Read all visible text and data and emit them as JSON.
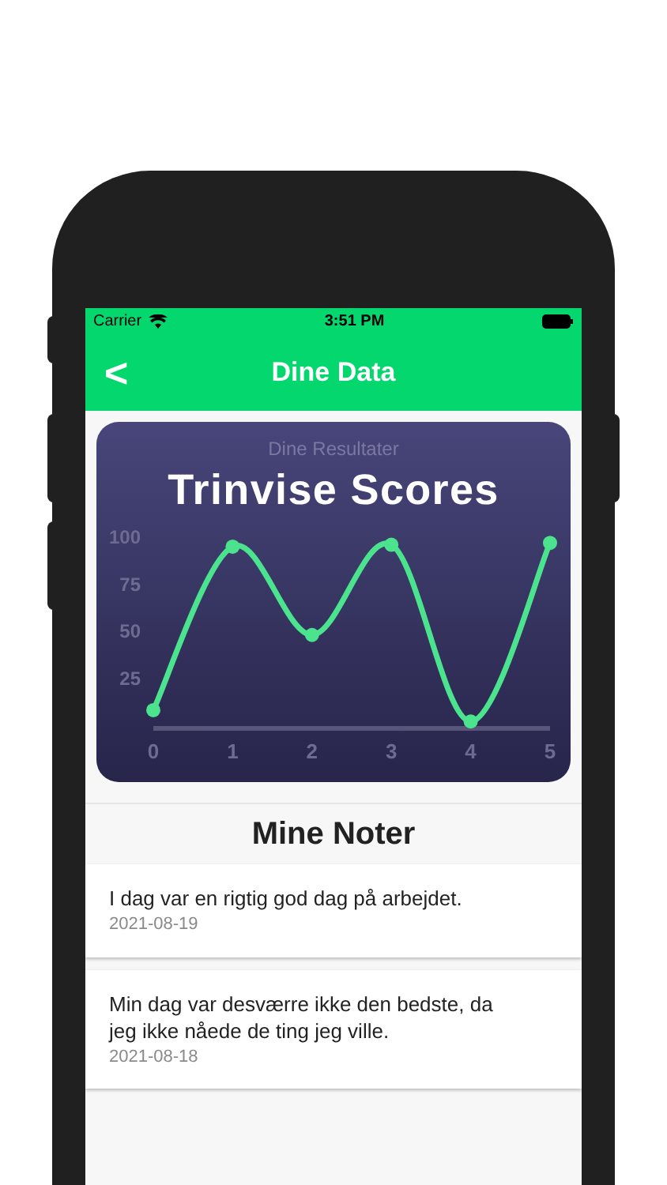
{
  "status_bar": {
    "carrier": "Carrier",
    "time": "3:51 PM"
  },
  "nav_bar": {
    "back": "<",
    "title": "Dine Data"
  },
  "chart_card": {
    "subtitle": "Dine Resultater",
    "title": "Trinvise Scores",
    "chart_data": {
      "type": "line",
      "x": [
        0,
        1,
        2,
        3,
        4,
        5
      ],
      "series": [
        {
          "color": "#4be38e",
          "marker": "circle",
          "values": [
            8,
            95,
            48,
            96,
            2,
            97
          ]
        }
      ],
      "xlim": [
        0,
        5
      ],
      "ylim": [
        0,
        100
      ],
      "yticks": [
        25,
        50,
        75,
        100
      ],
      "xticks": [
        0,
        1,
        2,
        3,
        4,
        5
      ]
    }
  },
  "notes": {
    "title": "Mine Noter",
    "items": [
      {
        "text": "I dag var en rigtig god dag på arbejdet.",
        "date": "2021-08-19"
      },
      {
        "text": "Min dag var desværre ikke den bedste, da jeg ikke nåede de ting jeg ville.",
        "date": "2021-08-18"
      }
    ]
  }
}
